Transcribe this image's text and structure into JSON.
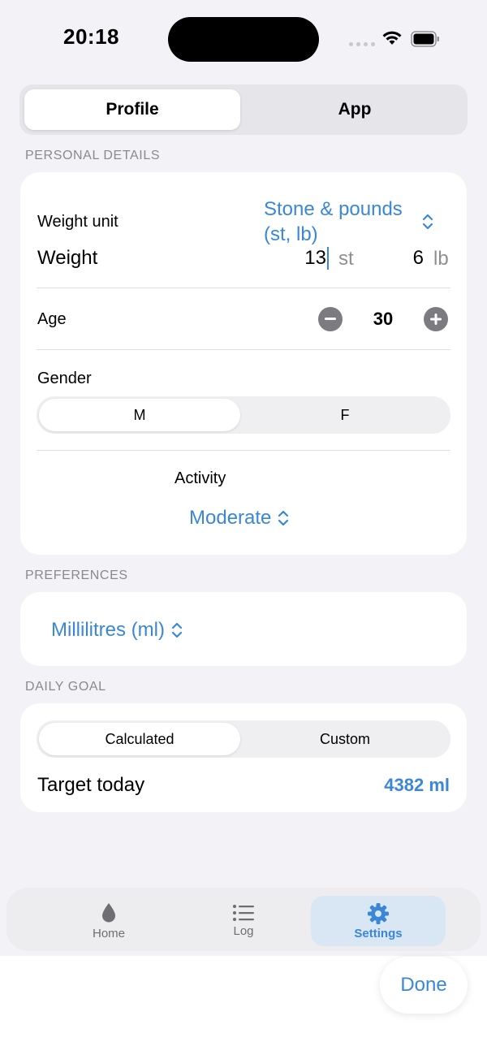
{
  "status_bar": {
    "time": "20:18"
  },
  "top_segment": {
    "options": [
      "Profile",
      "App"
    ],
    "selected": "Profile"
  },
  "personal_details": {
    "header": "PERSONAL DETAILS",
    "weight_unit_label": "Weight unit",
    "weight_unit_value_line1": "Stone & pounds",
    "weight_unit_value_line2": "(st, lb)",
    "weight_label": "Weight",
    "weight_stone": "13",
    "stone_unit": "st",
    "weight_pounds": "6",
    "pound_unit": "lb",
    "age_label": "Age",
    "age_value": "30",
    "gender_label": "Gender",
    "gender_options": [
      "M",
      "F"
    ],
    "gender_selected": "M",
    "activity_label": "Activity",
    "activity_value": "Moderate"
  },
  "preferences": {
    "header": "PREFERENCES",
    "unit_value": "Millilitres (ml)"
  },
  "daily_goal": {
    "header": "DAILY GOAL",
    "options": [
      "Calculated",
      "Custom"
    ],
    "selected": "Calculated",
    "target_label": "Target today",
    "target_value": "4382 ml"
  },
  "tab_bar": {
    "items": [
      {
        "label": "Home",
        "icon": "drop-icon"
      },
      {
        "label": "Log",
        "icon": "list-icon"
      },
      {
        "label": "Settings",
        "icon": "gear-icon"
      }
    ],
    "active": "Settings"
  },
  "done_label": "Done",
  "colors": {
    "accent": "#3a87d8",
    "background": "#f2f2f7"
  }
}
